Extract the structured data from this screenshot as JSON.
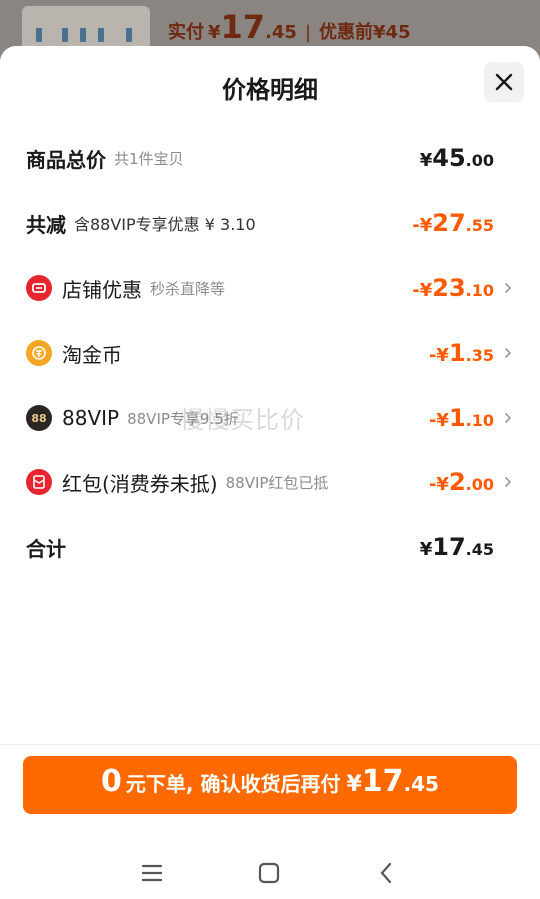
{
  "background": {
    "price_label": "实付",
    "currency": "¥",
    "price_int": "17",
    "price_dec": ".45",
    "separator": "|",
    "original_label": "优惠前",
    "original_price": "¥45"
  },
  "sheet": {
    "title": "价格明细",
    "close_icon": "close-icon"
  },
  "rows": {
    "total": {
      "label": "商品总价",
      "sub": "共1件宝贝",
      "prefix": "¥",
      "int": "45",
      "dec": ".00"
    },
    "reduce": {
      "label": "共减",
      "sub": "含88VIP专享优惠 ¥ 3.10",
      "prefix": "-¥",
      "int": "27",
      "dec": ".55"
    },
    "shop": {
      "label": "店铺优惠",
      "sub": "秒杀直降等",
      "prefix": "-¥",
      "int": "23",
      "dec": ".10",
      "icon": "shop-coupon-icon"
    },
    "coin": {
      "label": "淘金币",
      "sub": "",
      "prefix": "-¥",
      "int": "1",
      "dec": ".35",
      "icon": "gold-coin-icon"
    },
    "vip": {
      "label": "88VIP",
      "sub": "88VIP专享9.5折",
      "prefix": "-¥",
      "int": "1",
      "dec": ".10",
      "icon": "vip-88-icon",
      "icon_text": "88"
    },
    "redpacket": {
      "label": "红包(消费券未抵)",
      "sub": "88VIP红包已抵",
      "prefix": "-¥",
      "int": "2",
      "dec": ".00",
      "icon": "red-packet-icon"
    },
    "sum": {
      "label": "合计",
      "prefix": "¥",
      "int": "17",
      "dec": ".45"
    }
  },
  "watermark": "慢慢买比价",
  "cta": {
    "zero": "0",
    "text": "元下单, 确认收货后再付",
    "currency": "¥",
    "int": "17",
    "dec": ".45"
  },
  "navbar": {
    "menu": "menu-icon",
    "home": "home-icon",
    "back": "back-icon"
  },
  "colors": {
    "accent": "#ff6a00",
    "discount": "#ff5a00",
    "red_icon": "#e8252e",
    "gold_icon": "#f6a623"
  }
}
